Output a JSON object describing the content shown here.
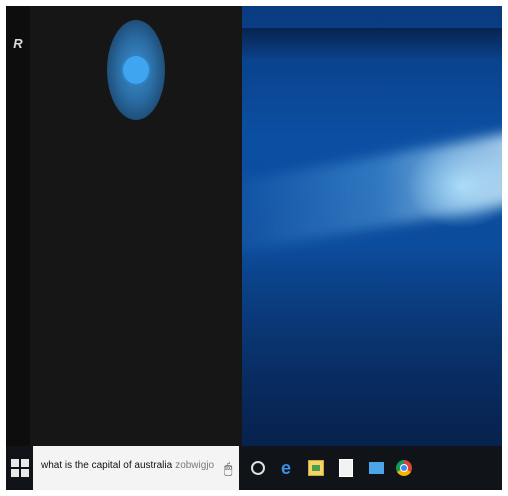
{
  "cortana": {
    "rail_icon": "cortana-logo-icon",
    "accent_color": "#3fa5f0"
  },
  "taskbar": {
    "search": {
      "typed_text": "what is the capital of australia",
      "hint_text": "zobwigjo"
    },
    "icons": [
      "windows-logo-icon",
      "task-view-icon",
      "edge-icon",
      "store-icon",
      "office-icon",
      "mail-icon",
      "chrome-icon"
    ]
  },
  "colors": {
    "panel_bg": "#161616",
    "taskbar_bg": "#101418",
    "desktop_blue": "#0b4fa3"
  }
}
